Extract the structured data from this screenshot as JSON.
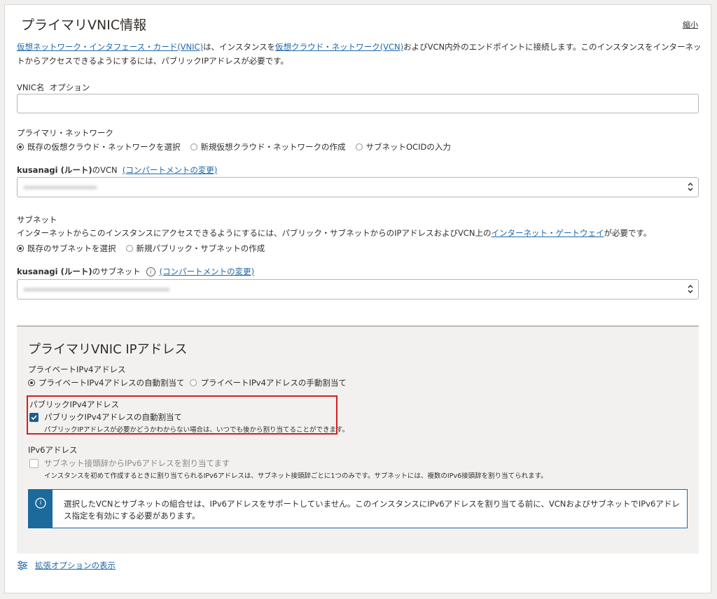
{
  "section": {
    "title": "プライマリVNIC情報",
    "collapse_label": "縮小",
    "desc_link1": "仮想ネットワーク・インタフェース・カード(VNIC)",
    "desc_text1": "は、インスタンスを",
    "desc_link2": "仮想クラウド・ネットワーク(VCN)",
    "desc_text2": "およびVCN内外のエンドポイントに接続します。このインスタンスをインターネットからアクセスできるようにするには、パブリックIPアドレスが必要です。"
  },
  "vnic_name": {
    "label": "VNIC名",
    "optional": "オプション",
    "value": ""
  },
  "primary_network": {
    "label": "プライマリ・ネットワーク",
    "options": [
      "既存の仮想クラウド・ネットワークを選択",
      "新規仮想クラウド・ネットワークの作成",
      "サブネットOCIDの入力"
    ],
    "selected_index": 0
  },
  "vcn": {
    "label_bold": "kusanagi (ルート)",
    "label_suffix": "のVCN",
    "change_link": "(コンパートメントの変更)"
  },
  "subnet": {
    "label": "サブネット",
    "desc_text": "インターネットからこのインスタンスにアクセスできるようにするには、パブリック・サブネットからのIPアドレスおよびVCN上の",
    "desc_link": "インターネット・ゲートウェイ",
    "desc_tail": "が必要です。",
    "options": [
      "既存のサブネットを選択",
      "新規パブリック・サブネットの作成"
    ],
    "selected_index": 0,
    "select_label_bold": "kusanagi (ルート)",
    "select_label_suffix": "のサブネット",
    "info_glyph": "i",
    "change_link": "(コンパートメントの変更)"
  },
  "ip_panel": {
    "title": "プライマリVNIC IPアドレス",
    "private_label": "プライベートIPv4アドレス",
    "private_options": [
      "プライベートIPv4アドレスの自動割当て",
      "プライベートIPv4アドレスの手動割当て"
    ],
    "private_selected_index": 0,
    "public_label": "パブリックIPv4アドレス",
    "public_checkbox_label": "パブリックIPv4アドレスの自動割当て",
    "public_checked": true,
    "public_hint": "パブリックIPアドレスが必要かどうかわからない場合は、いつでも後から割り当てることができます。",
    "ipv6_label": "IPv6アドレス",
    "ipv6_checkbox_label": "サブネット接頭辞からIPv6アドレスを割り当てます",
    "ipv6_checked": false,
    "ipv6_hint": "インスタンスを初めて作成するときに割り当てられるIPv6アドレスは、サブネット接頭辞ごとに1つのみです。サブネットには、複数のIPv6接頭辞を割り当てられます。",
    "notice_glyph": "i",
    "notice_text": "選択したVCNとサブネットの組合せは、IPv6アドレスをサポートしていません。このインスタンスにIPv6アドレスを割り当てる前に、VCNおよびサブネットでIPv6アドレス指定を有効にする必要があります。"
  },
  "advanced_options_link": "拡張オプションの表示",
  "colors": {
    "link": "#1e67a8",
    "checkbox": "#1b5f8c",
    "highlight": "#d11f1f",
    "notice": "#1c6a9b"
  }
}
